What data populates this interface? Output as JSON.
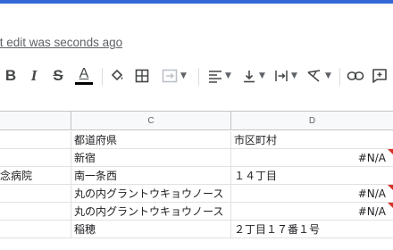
{
  "header": {
    "last_edit_text": "Last edit was seconds ago"
  },
  "toolbar": {
    "bold": "B",
    "italic": "I",
    "strikethrough": "S",
    "text_color_letter": "A",
    "text_color": "#000000",
    "items": [
      "bold-icon",
      "italic-icon",
      "strikethrough-icon",
      "text-color-icon",
      "fill-color-icon",
      "borders-icon",
      "merge-cells-icon",
      "horizontal-align-icon",
      "vertical-align-icon",
      "text-wrapping-icon",
      "text-rotation-icon",
      "insert-link-icon",
      "insert-comment-icon"
    ]
  },
  "sheet": {
    "columns": [
      {
        "label": ""
      },
      {
        "label": "C"
      },
      {
        "label": "D"
      }
    ],
    "rows": [
      {
        "b": "",
        "c": "都道府県",
        "d": "市区町村",
        "d_error": false
      },
      {
        "b": "",
        "c": "新宿",
        "d": "#N/A",
        "d_error": true
      },
      {
        "b": "念病院",
        "c": "南一条西",
        "d": "１４丁目",
        "d_error": false
      },
      {
        "b": "",
        "c": "丸の内グラントウキョウノース",
        "d": "#N/A",
        "d_error": true
      },
      {
        "b": "",
        "c": "丸の内グラントウキョウノース",
        "d": "#N/A",
        "d_error": true
      },
      {
        "b": "",
        "c": "稲穂",
        "d": "２丁目１７番１号",
        "d_error": false
      }
    ],
    "error_flag_color": "#d93025"
  }
}
